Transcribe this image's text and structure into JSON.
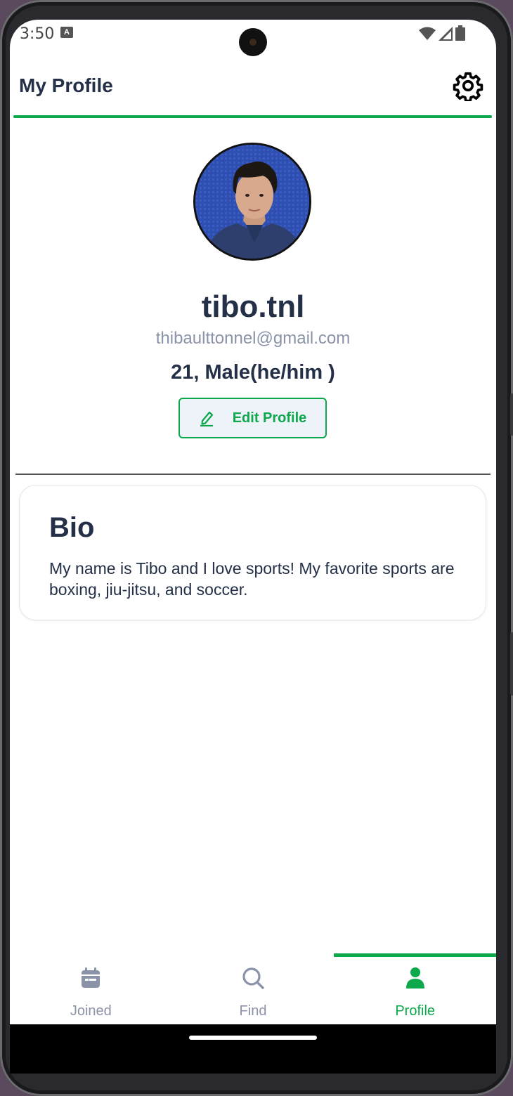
{
  "status_bar": {
    "time": "3:50",
    "notification_icon": "a-notification-icon"
  },
  "header": {
    "title": "My Profile",
    "settings_icon": "gear-icon"
  },
  "profile": {
    "username": "tibo.tnl",
    "email": "thibaulttonnel@gmail.com",
    "age_gender": "21, Male(he/him )",
    "edit_label": "Edit Profile"
  },
  "bio": {
    "title": "Bio",
    "text": "My name is Tibo and I love sports! My favorite sports are boxing, jiu-jitsu, and soccer."
  },
  "nav": {
    "items": [
      {
        "label": "Joined",
        "icon": "calendar-icon",
        "active": false
      },
      {
        "label": "Find",
        "icon": "search-icon",
        "active": false
      },
      {
        "label": "Profile",
        "icon": "person-icon",
        "active": true
      }
    ]
  },
  "colors": {
    "accent": "#0da84b",
    "text_dark": "#233047",
    "text_muted": "#8a93a8"
  }
}
